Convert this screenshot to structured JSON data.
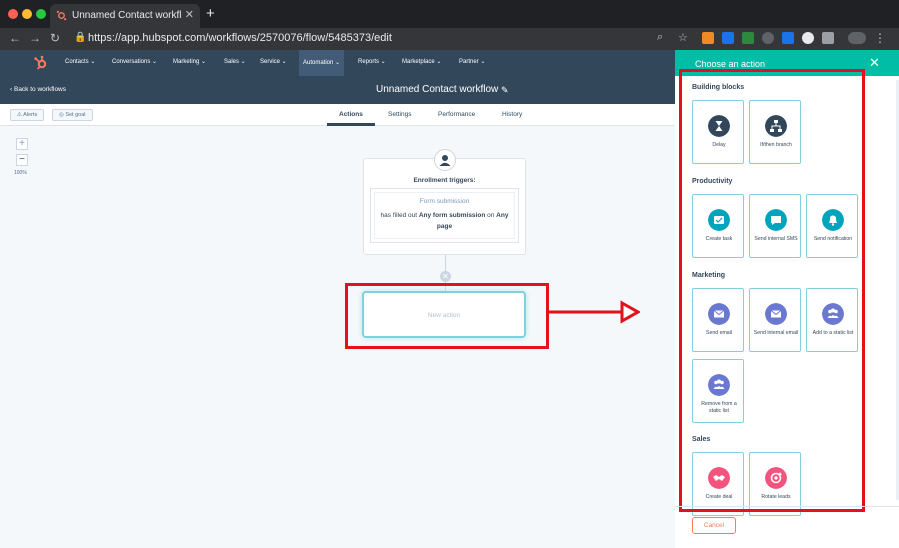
{
  "browser": {
    "tab_title": "Unnamed Contact workflow | H",
    "url": "https://app.hubspot.com/workflows/2570076/flow/5485373/edit"
  },
  "nav": {
    "items": [
      "Contacts",
      "Conversations",
      "Marketing",
      "Sales",
      "Service",
      "Automation",
      "Reports",
      "Marketplace",
      "Partner"
    ],
    "active": "Automation"
  },
  "header": {
    "back_label": "Back to workflows",
    "title": "Unnamed Contact workflow"
  },
  "toolbar": {
    "alerts_label": "Alerts",
    "set_goal_label": "Set goal",
    "tabs": [
      "Actions",
      "Settings",
      "Performance",
      "History"
    ],
    "active_tab": "Actions"
  },
  "canvas": {
    "zoom_level": "100%",
    "trigger_title": "Enrollment triggers:",
    "trigger_type": "Form submission",
    "trigger_desc_1": "has filled out",
    "trigger_desc_2": "Any form submission",
    "trigger_desc_3": "on",
    "trigger_desc_4": "Any page",
    "new_action_label": "New action"
  },
  "panel": {
    "title": "Choose an action",
    "cancel_label": "Cancel",
    "sections": [
      {
        "name": "Building blocks",
        "cards": [
          {
            "label": "Delay",
            "icon": "hourglass-icon"
          },
          {
            "label": "If/then branch",
            "icon": "branch-icon"
          }
        ]
      },
      {
        "name": "Productivity",
        "cards": [
          {
            "label": "Create task",
            "icon": "task-icon"
          },
          {
            "label": "Send internal SMS",
            "icon": "sms-icon"
          },
          {
            "label": "Send notification",
            "icon": "bell-icon"
          }
        ]
      },
      {
        "name": "Marketing",
        "cards": [
          {
            "label": "Send email",
            "icon": "email-icon"
          },
          {
            "label": "Send internal email",
            "icon": "email-icon"
          },
          {
            "label": "Add to a static list",
            "icon": "contacts-icon"
          },
          {
            "label": "Remove from a static list",
            "icon": "contacts-icon"
          }
        ]
      },
      {
        "name": "Sales",
        "cards": [
          {
            "label": "Create deal",
            "icon": "handshake-icon"
          },
          {
            "label": "Rotate leads",
            "icon": "rotate-icon"
          }
        ]
      }
    ],
    "colors": {
      "teal": "#00bda5",
      "blocks": "#33475b",
      "productivity": "#00a4bd",
      "marketing": "#6a78d1",
      "sales": "#f2547d"
    }
  }
}
